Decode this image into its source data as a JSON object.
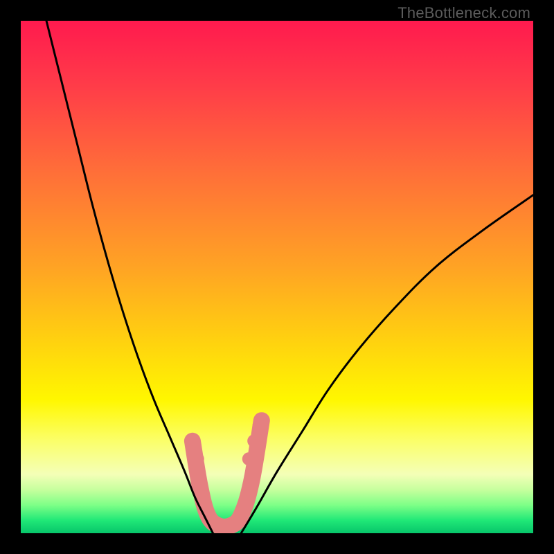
{
  "watermark": "TheBottleneck.com",
  "chart_data": {
    "type": "line",
    "title": "",
    "xlabel": "",
    "ylabel": "",
    "xlim": [
      0,
      100
    ],
    "ylim": [
      0,
      100
    ],
    "series": [
      {
        "name": "left-curve",
        "x": [
          5,
          8,
          11,
          14,
          17,
          20,
          23,
          26,
          29,
          32,
          34,
          36,
          37.5
        ],
        "y": [
          100,
          88,
          76,
          64,
          53,
          43,
          34,
          26,
          19,
          12,
          7,
          3,
          0
        ]
      },
      {
        "name": "right-curve",
        "x": [
          43,
          46,
          50,
          55,
          60,
          66,
          73,
          81,
          90,
          100
        ],
        "y": [
          0,
          5,
          12,
          20,
          28,
          36,
          44,
          52,
          59,
          66
        ]
      }
    ],
    "markers": {
      "name": "curve-markers",
      "points": [
        {
          "x": 34.0,
          "y": 17.0
        },
        {
          "x": 34.5,
          "y": 14.5
        },
        {
          "x": 44.5,
          "y": 14.5
        },
        {
          "x": 45.5,
          "y": 18.0
        },
        {
          "x": 46.5,
          "y": 21.0
        }
      ]
    },
    "pink_band": {
      "name": "valley-band",
      "path": [
        {
          "x": 33.5,
          "y": 18.0
        },
        {
          "x": 35.0,
          "y": 9.0
        },
        {
          "x": 36.5,
          "y": 3.5
        },
        {
          "x": 38.5,
          "y": 1.5
        },
        {
          "x": 41.0,
          "y": 1.5
        },
        {
          "x": 43.0,
          "y": 3.5
        },
        {
          "x": 45.0,
          "y": 10.0
        },
        {
          "x": 47.0,
          "y": 22.0
        }
      ]
    },
    "gradient_stops": [
      {
        "offset": 0.0,
        "color": "#ff1a4e"
      },
      {
        "offset": 0.12,
        "color": "#ff3a49"
      },
      {
        "offset": 0.3,
        "color": "#ff7038"
      },
      {
        "offset": 0.48,
        "color": "#ffa324"
      },
      {
        "offset": 0.62,
        "color": "#ffd010"
      },
      {
        "offset": 0.74,
        "color": "#fff700"
      },
      {
        "offset": 0.82,
        "color": "#fbff6a"
      },
      {
        "offset": 0.885,
        "color": "#f4ffb7"
      },
      {
        "offset": 0.915,
        "color": "#c7ff9e"
      },
      {
        "offset": 0.945,
        "color": "#7eff87"
      },
      {
        "offset": 0.975,
        "color": "#20e877"
      },
      {
        "offset": 1.0,
        "color": "#07c56a"
      }
    ]
  }
}
